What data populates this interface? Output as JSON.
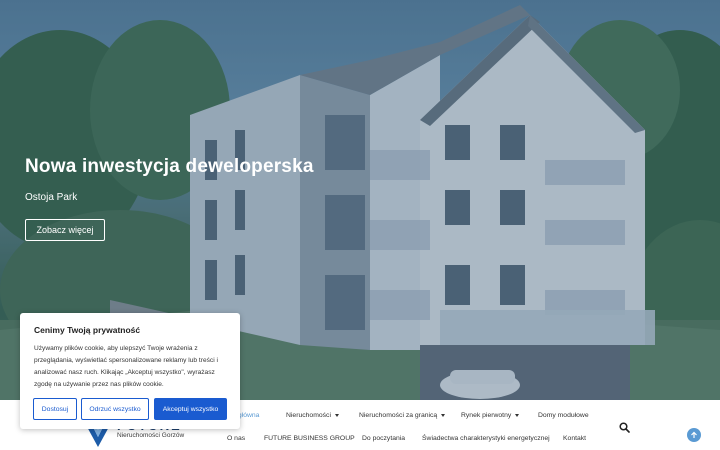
{
  "hero": {
    "title": "Nowa inwestycja deweloperska",
    "subtitle": "Ostoja Park",
    "button_label": "Zobacz więcej"
  },
  "logo": {
    "wordmark": "FUTURE",
    "tagline": "Nieruchomości Gorzów",
    "icon": "logo-chevron-icon"
  },
  "nav": {
    "row1": [
      {
        "label": "Strona główna",
        "dropdown": false,
        "active": true
      },
      {
        "label": "Nieruchomości",
        "dropdown": true,
        "active": false
      },
      {
        "label": "Nieruchomości za granicą",
        "dropdown": true,
        "active": false
      },
      {
        "label": "Rynek pierwotny",
        "dropdown": true,
        "active": false
      },
      {
        "label": "Domy modułowe",
        "dropdown": false,
        "active": false
      }
    ],
    "row2": [
      {
        "label": "O nas"
      },
      {
        "label": "FUTURE BUSINESS GROUP"
      },
      {
        "label": "Do poczytania"
      },
      {
        "label": "Świadectwa charakterystyki energetycznej"
      },
      {
        "label": "Kontakt"
      }
    ],
    "search_icon": "search-icon",
    "scroll_top_icon": "arrow-up-icon"
  },
  "cookie": {
    "title": "Cenimy Twoją prywatność",
    "text": "Używamy plików cookie, aby ulepszyć Twoje wrażenia z przeglądania, wyświetlać spersonalizowane reklamy lub treści i analizować nasz ruch. Klikając „Akceptuj wszystko\", wyrażasz zgodę na używanie przez nas plików cookie.",
    "customize_label": "Dostosuj",
    "reject_label": "Odrzuć wszystko",
    "accept_label": "Akceptuj wszystko"
  },
  "colors": {
    "accent": "#1a5bd0",
    "nav_active": "#5a9ad3",
    "brand_navy": "#1d3f6c"
  }
}
